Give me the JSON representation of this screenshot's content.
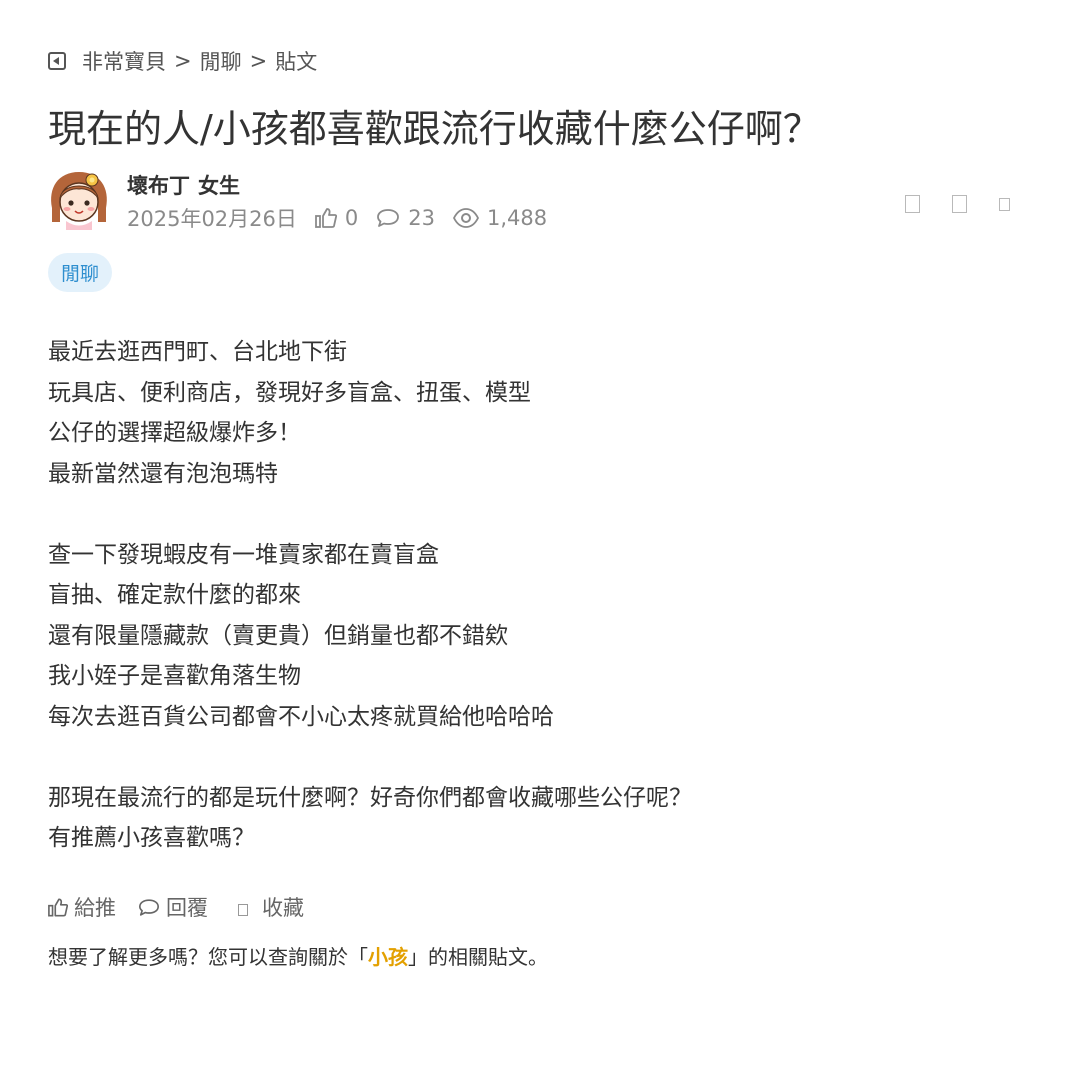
{
  "breadcrumb": {
    "items": [
      "非常寶貝",
      "閒聊",
      "貼文"
    ],
    "separator": ">"
  },
  "post": {
    "title": "現在的人/小孩都喜歡跟流行收藏什麼公仔啊？",
    "author": {
      "name": "壞布丁",
      "gender": "女生"
    },
    "date": "2025年02月26日",
    "likes": "0",
    "comments": "23",
    "views": "1,488",
    "tag": "閒聊",
    "content": [
      [
        "最近去逛西門町、台北地下街",
        "玩具店、便利商店，發現好多盲盒、扭蛋、模型",
        "公仔的選擇超級爆炸多！",
        "最新當然還有泡泡瑪特"
      ],
      [
        "查一下發現蝦皮有一堆賣家都在賣盲盒",
        "盲抽、確定款什麼的都來",
        "還有限量隱藏款（賣更貴）但銷量也都不錯欸",
        "我小姪子是喜歡角落生物",
        "每次去逛百貨公司都會不小心太疼就買給他哈哈哈"
      ],
      [
        "那現在最流行的都是玩什麼啊？好奇你們都會收藏哪些公仔呢？",
        "有推薦小孩喜歡嗎？"
      ]
    ]
  },
  "bottom": {
    "like": "給推",
    "reply": "回覆",
    "bookmark": "收藏"
  },
  "related": {
    "prefix": "想要了解更多嗎？您可以查詢關於「",
    "keyword": "小孩",
    "suffix": "」的相關貼文。"
  },
  "colors": {
    "tag_bg": "#e3f1fb",
    "tag_text": "#2f8fcf",
    "keyword": "#e3a000"
  },
  "icons": [
    "back-icon",
    "thumb-up-icon",
    "comment-icon",
    "eye-icon",
    "bookmark-icon"
  ]
}
